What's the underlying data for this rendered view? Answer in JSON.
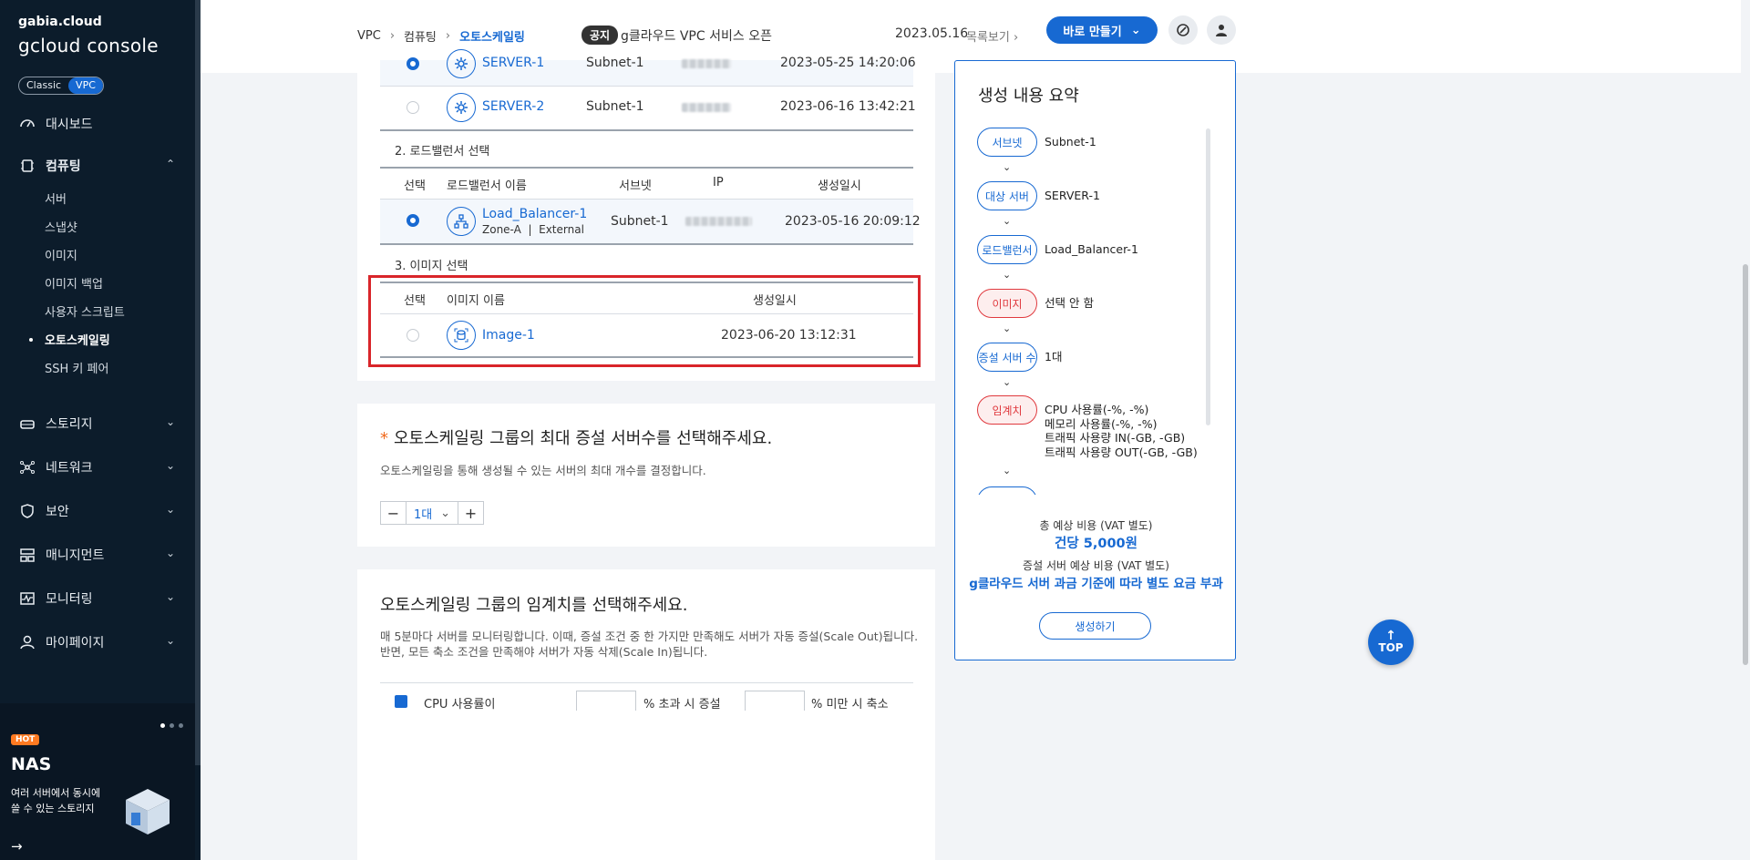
{
  "sidebar": {
    "logo_small": "gabia.cloud",
    "logo_big": "gcloud console",
    "mode_classic": "Classic",
    "mode_vpc": "VPC",
    "items": {
      "dashboard": "대시보드",
      "computing": "컴퓨팅",
      "storage": "스토리지",
      "network": "네트워크",
      "security": "보안",
      "management": "매니지먼트",
      "monitoring": "모니터링",
      "mypage": "마이페이지"
    },
    "computing_sub": [
      "서버",
      "스냅샷",
      "이미지",
      "이미지 백업",
      "사용자 스크립트",
      "오토스케일링",
      "SSH 키 페어"
    ],
    "active_sub": "오토스케일링",
    "promo": {
      "badge": "HOT",
      "title": "NAS",
      "line1": "여러 서버에서 동시에",
      "line2": "쓸 수 있는 스토리지"
    }
  },
  "header": {
    "breadcrumb": [
      "VPC",
      "컴퓨팅",
      "오토스케일링"
    ],
    "notice_badge": "공지",
    "notice_text": "g클라우드 VPC 서비스 오픈",
    "notice_date": "2023.05.16",
    "notice_more": "목록보기",
    "create_button": "바로 만들기"
  },
  "servers": [
    {
      "name": "SERVER-1",
      "subnet": "Subnet-1",
      "created": "2023-05-25 14:20:06",
      "selected": true
    },
    {
      "name": "SERVER-2",
      "subnet": "Subnet-1",
      "created": "2023-06-16 13:42:21",
      "selected": false
    }
  ],
  "lb_section": {
    "title": "2. 로드밸런서 선택",
    "headers": {
      "select": "선택",
      "name": "로드밸런서 이름",
      "subnet": "서브넷",
      "ip": "IP",
      "created": "생성일시"
    },
    "row": {
      "name": "Load_Balancer-1",
      "detail": "Zone-A  |  External",
      "subnet": "Subnet-1",
      "created": "2023-05-16 20:09:12",
      "selected": true
    }
  },
  "image_section": {
    "title": "3. 이미지 선택",
    "headers": {
      "select": "선택",
      "name": "이미지 이름",
      "created": "생성일시"
    },
    "row": {
      "name": "Image-1",
      "created": "2023-06-20 13:12:31",
      "selected": false
    }
  },
  "max_servers": {
    "required_mark": "*",
    "title": "오토스케일링 그룹의 최대 증설 서버수를 선택해주세요.",
    "desc": "오토스케일링을 통해 생성될 수 있는 서버의 최대 개수를 결정합니다.",
    "value": "1대",
    "minus": "−",
    "plus": "+"
  },
  "threshold": {
    "title": "오토스케일링 그룹의 임계치를 선택해주세요.",
    "desc1": "매 5분마다 서버를 모니터링합니다. 이때, 증설 조건 중 한 가지만 만족해도 서버가 자동 증설(Scale Out)됩니다.",
    "desc2": "반면, 모든 축소 조건을 만족해야 서버가 자동 삭제(Scale In)됩니다.",
    "cpu_label": "CPU 사용률이",
    "over_label": "% 초과 시 증설",
    "under_label": "% 미만 시 축소"
  },
  "summary": {
    "title": "생성 내용 요약",
    "items": [
      {
        "label": "서브넷",
        "value": "Subnet-1",
        "state": "ok"
      },
      {
        "label": "대상 서버",
        "value": "SERVER-1",
        "state": "ok"
      },
      {
        "label": "로드밸런서",
        "value": "Load_Balancer-1",
        "state": "ok"
      },
      {
        "label": "이미지",
        "value": "선택 안 함",
        "state": "missing"
      },
      {
        "label": "증설 서버 수",
        "value": "1대",
        "state": "ok"
      },
      {
        "label": "임계치",
        "value": "",
        "state": "missing"
      }
    ],
    "threshold_lines": [
      "CPU 사용률(-%, -%)",
      "메모리 사용률(-%, -%)",
      "트래픽 사용량 IN(-GB, -GB)",
      "트래픽 사용량 OUT(-GB, -GB)"
    ],
    "cost_label": "총 예상 비용 (VAT 별도)",
    "cost_value": "건당 5,000원",
    "extra_label": "증설 서버 예상 비용 (VAT 별도)",
    "extra_value": "g클라우드 서버 과금 기준에 따라 별도 요금 부과",
    "create_button": "생성하기"
  },
  "top_button": "TOP",
  "colors": {
    "accent": "#1769d2",
    "sidebar_bg": "#0c1c2b",
    "warning": "#e0393e",
    "highlight": "#d9252a"
  }
}
